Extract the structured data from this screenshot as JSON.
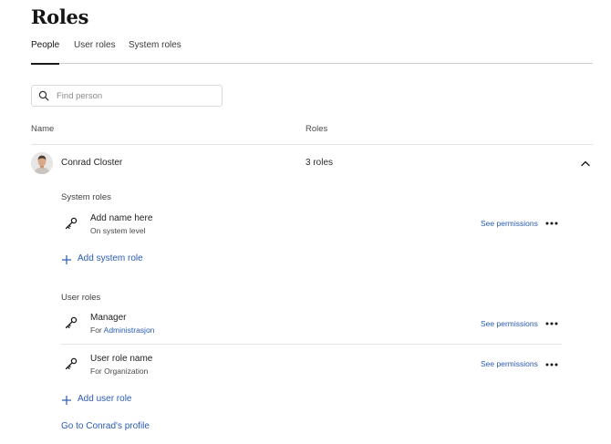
{
  "header": {
    "title": "Roles"
  },
  "tabs": [
    {
      "label": "People",
      "active": true
    },
    {
      "label": "User roles",
      "active": false
    },
    {
      "label": "System roles",
      "active": false
    }
  ],
  "search": {
    "placeholder": "Find person",
    "value": ""
  },
  "table": {
    "columns": [
      "Name",
      "Roles"
    ],
    "person": {
      "name": "Conrad Closter",
      "roles_count": "3 roles"
    }
  },
  "system_roles": {
    "title": "System roles",
    "items": [
      {
        "name": "Add name here",
        "sub": "On system level",
        "permissions_label": "See permissions"
      }
    ],
    "add_label": "Add system role"
  },
  "user_roles": {
    "title": "User roles",
    "items": [
      {
        "name": "Manager",
        "sub_prefix": "For",
        "sub_link": "Administrasjon",
        "permissions_label": "See permissions"
      },
      {
        "name": "User role name",
        "sub": "For Organization",
        "permissions_label": "See permissions"
      }
    ],
    "add_label": "Add user role"
  },
  "profile_link": "Go to Conrad's profile",
  "colors": {
    "link": "#2a5bb5",
    "text": "#1f1f1f",
    "divider": "#e4e4e4"
  },
  "icons": [
    "search-icon",
    "avatar",
    "chevron-up-icon",
    "key-icon",
    "plus-icon",
    "more-icon"
  ]
}
